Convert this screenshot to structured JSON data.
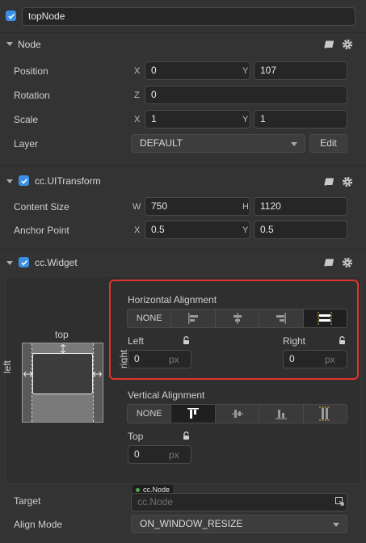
{
  "node": {
    "enabled": true,
    "name": "topNode"
  },
  "sections": {
    "node": "Node",
    "transform": "cc.UITransform",
    "widget": "cc.Widget"
  },
  "node_props": {
    "position": {
      "label": "Position",
      "x_axis": "X",
      "x": "0",
      "y_axis": "Y",
      "y": "107"
    },
    "rotation": {
      "label": "Rotation",
      "z_axis": "Z",
      "z": "0"
    },
    "scale": {
      "label": "Scale",
      "x_axis": "X",
      "x": "1",
      "y_axis": "Y",
      "y": "1"
    },
    "layer": {
      "label": "Layer",
      "value": "DEFAULT",
      "edit_label": "Edit"
    }
  },
  "transform_props": {
    "content_size": {
      "label": "Content Size",
      "w_axis": "W",
      "w": "750",
      "h_axis": "H",
      "h": "1120"
    },
    "anchor_point": {
      "label": "Anchor Point",
      "x_axis": "X",
      "x": "0.5",
      "y_axis": "Y",
      "y": "0.5"
    }
  },
  "widget": {
    "preview": {
      "top": "top",
      "left": "left",
      "right": "right"
    },
    "horizontal": {
      "title": "Horizontal Alignment",
      "none_label": "NONE",
      "options": [
        "NONE",
        "align-left",
        "align-center",
        "align-right",
        "align-stretch"
      ],
      "selected": "align-stretch",
      "left_label": "Left",
      "left_value": "0",
      "right_label": "Right",
      "right_value": "0",
      "unit": "px"
    },
    "vertical": {
      "title": "Vertical Alignment",
      "none_label": "NONE",
      "options": [
        "NONE",
        "align-top",
        "align-middle",
        "align-bottom",
        "align-stretch"
      ],
      "selected": "align-top",
      "top_label": "Top",
      "top_value": "0",
      "unit": "px"
    },
    "target": {
      "label": "Target",
      "tag": "cc.Node",
      "placeholder": "cc.Node"
    },
    "align_mode": {
      "label": "Align Mode",
      "value": "ON_WINDOW_RESIZE"
    }
  },
  "colors": {
    "highlight": "#e0332b",
    "accent": "#3a8ee6",
    "tag_dot": "#4caf50"
  }
}
